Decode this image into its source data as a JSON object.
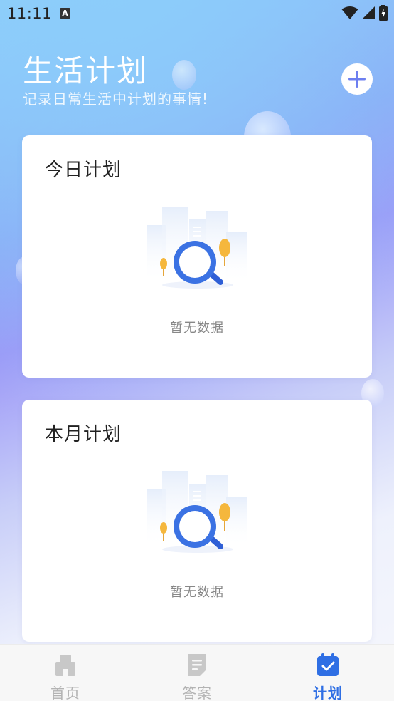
{
  "status_bar": {
    "time": "11:11",
    "notification_badge": "A",
    "icons": [
      "wifi-icon",
      "signal-icon",
      "battery-charging-icon"
    ]
  },
  "header": {
    "title": "生活计划",
    "subtitle": "记录日常生活中计划的事情!",
    "add_icon": "plus-icon"
  },
  "cards": {
    "today": {
      "title": "今日计划",
      "empty_text": "暂无数据"
    },
    "month": {
      "title": "本月计划",
      "empty_text": "暂无数据"
    }
  },
  "bottom_nav": {
    "items": [
      {
        "label": "首页",
        "icon": "home-icon",
        "active": false
      },
      {
        "label": "答案",
        "icon": "document-icon",
        "active": false
      },
      {
        "label": "计划",
        "icon": "calendar-check-icon",
        "active": true
      }
    ]
  },
  "colors": {
    "accent": "#2f6fe4",
    "nav_inactive": "#b3b3b3",
    "card_background": "#ffffff",
    "gradient_top": "#8fd0fb",
    "gradient_mid": "#9c98f7"
  }
}
